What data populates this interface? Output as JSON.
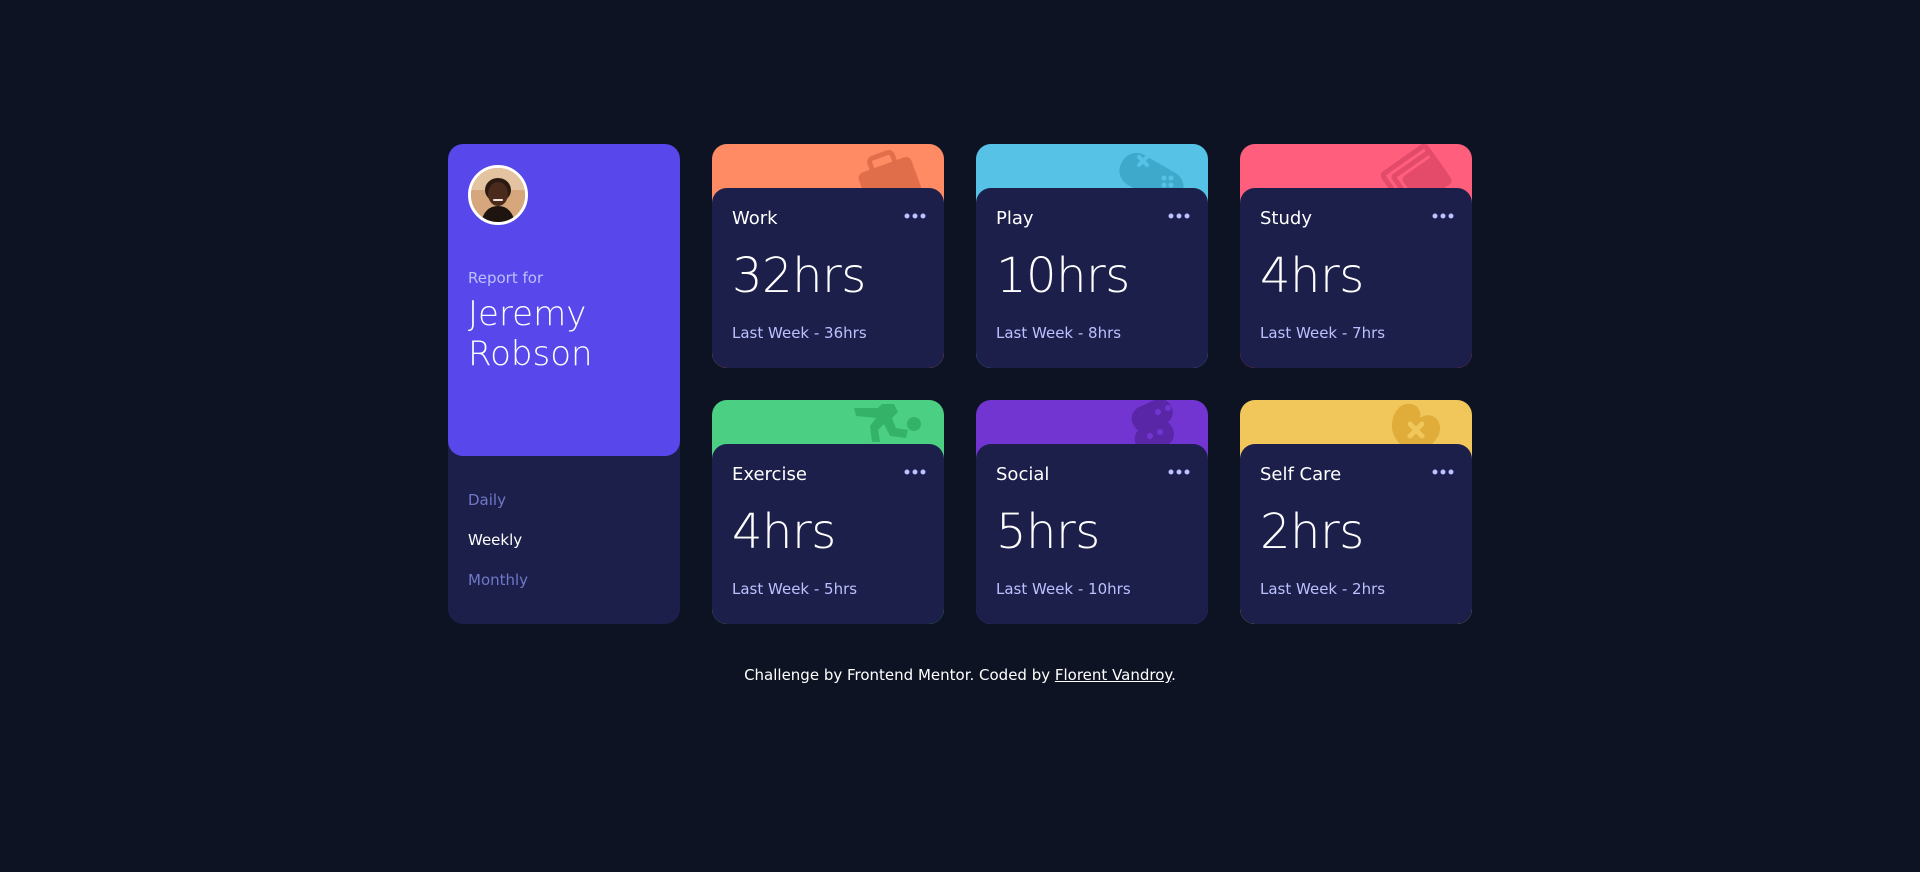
{
  "profile": {
    "report_for": "Report for",
    "name_line1": "Jeremy",
    "name_line2": "Robson",
    "periods": [
      "Daily",
      "Weekly",
      "Monthly"
    ],
    "active_period": "Weekly"
  },
  "cards": [
    {
      "title": "Work",
      "hours": "32hrs",
      "previous": "Last Week - 36hrs",
      "color": "#ff8b64",
      "icon": "briefcase-icon"
    },
    {
      "title": "Play",
      "hours": "10hrs",
      "previous": "Last Week - 8hrs",
      "color": "#55c2e6",
      "icon": "gamepad-icon"
    },
    {
      "title": "Study",
      "hours": "4hrs",
      "previous": "Last Week - 7hrs",
      "color": "#ff5e7d",
      "icon": "book-icon"
    },
    {
      "title": "Exercise",
      "hours": "4hrs",
      "previous": "Last Week - 5hrs",
      "color": "#4bcf82",
      "icon": "running-icon"
    },
    {
      "title": "Social",
      "hours": "5hrs",
      "previous": "Last Week - 10hrs",
      "color": "#7335d2",
      "icon": "social-icon"
    },
    {
      "title": "Self Care",
      "hours": "2hrs",
      "previous": "Last Week - 2hrs",
      "color": "#f1c75b",
      "icon": "heart-icon"
    }
  ],
  "footer": {
    "prefix": "Challenge by Frontend Mentor. Coded by ",
    "author": "Florent Vandroy",
    "suffix": "."
  },
  "colors": {
    "background": "#0e1323",
    "panel": "#1c1f4a",
    "profile": "#5847eb",
    "muted": "#7078c9",
    "pale": "#bbc0ff"
  }
}
